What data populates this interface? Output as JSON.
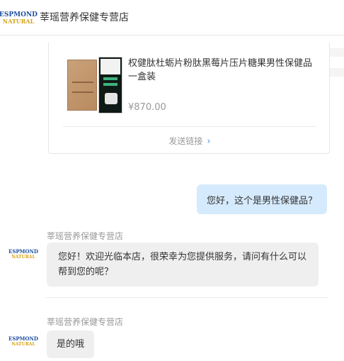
{
  "header": {
    "shop_name": "莘瑶营养保健专营店",
    "logo_top": "ESPMOND",
    "logo_bottom": "NATURAL"
  },
  "product_card": {
    "name": "权健肽杜蛎片粉肽黑莓片压片糖果男性保健品 一盒装",
    "price": "¥870.00",
    "send_link": "发送链接",
    "send_link_icon": "chevron-right-icon"
  },
  "messages": [
    {
      "side": "right",
      "text": "您好，这个是男性保健品？"
    },
    {
      "side": "left",
      "sender": "莘瑶营养保健专营店",
      "text": "您好！欢迎光临本店，很荣幸为您提供服务，请问有什么可以帮到您的呢？"
    },
    {
      "side": "left",
      "sender": "莘瑶营养保健专营店",
      "text": "是的哦"
    }
  ],
  "colors": {
    "bubble_right": "#d5eafc",
    "bubble_left": "#efefef",
    "link_accent": "#4a90e2"
  }
}
